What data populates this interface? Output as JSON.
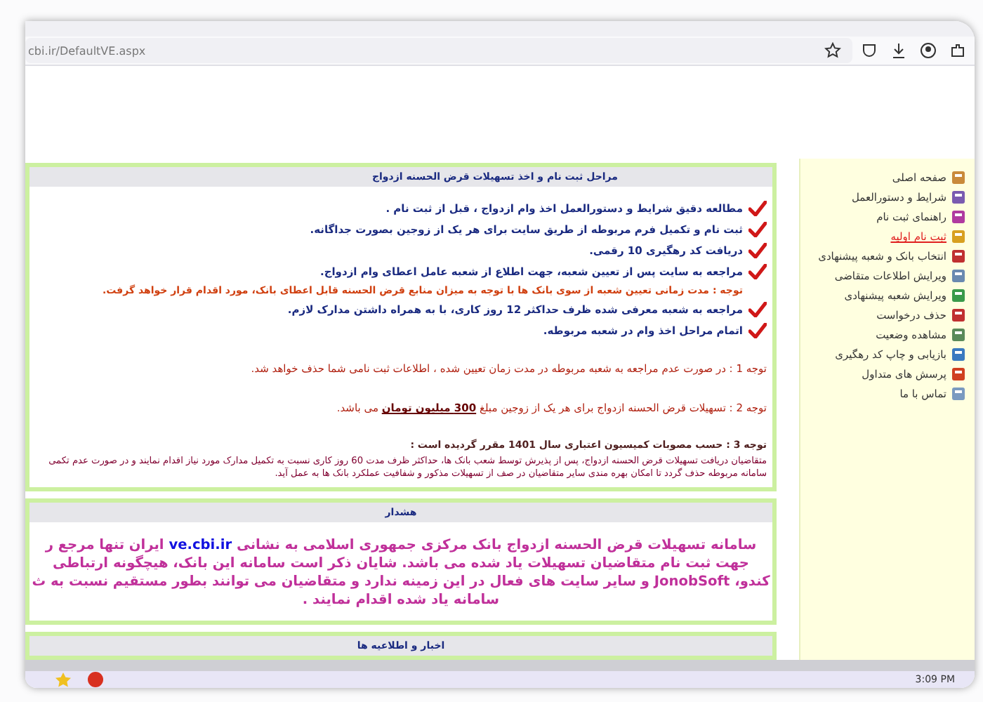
{
  "browser": {
    "url": "cbi.ir/DefaultVE.aspx"
  },
  "sidebar": {
    "items": [
      {
        "label": "صفحه اصلی",
        "selected": false
      },
      {
        "label": "شرایط و دستورالعمل",
        "selected": false
      },
      {
        "label": "راهنمای ثبت نام",
        "selected": false
      },
      {
        "label": "ثبت نام اولیه",
        "selected": true
      },
      {
        "label": "انتخاب بانک و شعبه پیشنهادی",
        "selected": false
      },
      {
        "label": "ویرایش اطلاعات متقاضی",
        "selected": false
      },
      {
        "label": "ویرایش شعبه پیشنهادی",
        "selected": false
      },
      {
        "label": "حذف درخواست",
        "selected": false
      },
      {
        "label": "مشاهده وضعیت",
        "selected": false
      },
      {
        "label": "بازیابی و چاپ کد رهگیری",
        "selected": false
      },
      {
        "label": "پرسش های متداول",
        "selected": false
      },
      {
        "label": "تماس با ما",
        "selected": false
      }
    ]
  },
  "steps_panel": {
    "title": "مراحل ثبت نام و اخذ تسهیلات قرض الحسنه ازدواج",
    "items": [
      {
        "kind": "step",
        "text": "مطالعه دقیق شرایط و دستورالعمل اخذ وام ازدواج ، قبل از ثبت نام ."
      },
      {
        "kind": "step",
        "text": "ثبت نام و تکمیل فرم مربوطه از طریق سایت برای هر یک از زوجین بصورت جداگانه."
      },
      {
        "kind": "step",
        "text": "دریافت کد رهگیری 10 رقمی."
      },
      {
        "kind": "step",
        "text": "مراجعه به سایت پس از تعیین شعبه، جهت اطلاع از شعبه عامل اعطای وام ازدواج."
      },
      {
        "kind": "note",
        "text": "توجه : مدت زمانی تعیین شعبه از سوی بانک ها با توجه به میزان منابع قرض الحسنه قابل اعطای بانک، مورد اقدام قرار خواهد گرفت."
      },
      {
        "kind": "step",
        "text": "مراجعه به شعبه معرفی شده ظرف حداکثر 12 روز کاری، با به همراه داشتن مدارک لازم."
      },
      {
        "kind": "step",
        "text": "اتمام مراحل اخذ وام در شعبه مربوطه."
      }
    ],
    "notes": [
      {
        "kind": "simple",
        "text": "توجه 1 :  در صورت عدم مراجعه به شعبه مربوطه در مدت زمان تعیین شده ، اطلاعات ثبت نامی شما حذف خواهد شد."
      },
      {
        "kind": "simple",
        "text": "توجه 2 :  تسهیلات قرض الحسنه ازدواج برای هر یک از زوجین مبلغ **300 میلیون تومان** می باشد."
      },
      {
        "kind": "detailed",
        "text": "توجه 3 : حسب مصوبات کمیسیون اعتباری سال 1401 مقرر گردیده است :",
        "body": "متقاضیان دریافت تسهیلات قرض الحسنه ازدواج، پس از پذیرش توسط شعب بانک ها، حداکثر ظرف مدت 60 روز کاری نسبت به تکمیل مدارک مورد نیاز اقدام نمایند و در صورت عدم تکمی\nسامانه مربوطه حذف گردد تا امکان بهره مندی سایر متقاضیان در صف از تسهیلات مذکور و شفافیت عملکرد بانک ها به عمل آید."
      }
    ]
  },
  "warning": {
    "title": "هشدار",
    "lines": [
      {
        "text": "سامانه تسهیلات قرض الحسنه ازدواج بانک مرکزی جمهوری اسلامی به نشانی",
        "link": "ve.cbi.ir",
        "after": "ایران تنها مرجع ر"
      },
      {
        "text": "جهت ثبت نام متقاضیان تسهیلات یاد شده می باشد. شایان ذکر است سامانه این بانک، هیچگونه ارتباطی"
      },
      {
        "text": "کندو، **JonobSoft** و سایر سایت های فعال در این زمینه ندارد و متقاضیان می توانند بطور مستقیم نسبت به ث"
      },
      {
        "text": "سامانه یاد شده اقدام نمایند ."
      }
    ]
  },
  "news": {
    "title": "اخبار و اطلاعیه ها"
  },
  "taskbar": {
    "clock": "3:09 PM"
  }
}
